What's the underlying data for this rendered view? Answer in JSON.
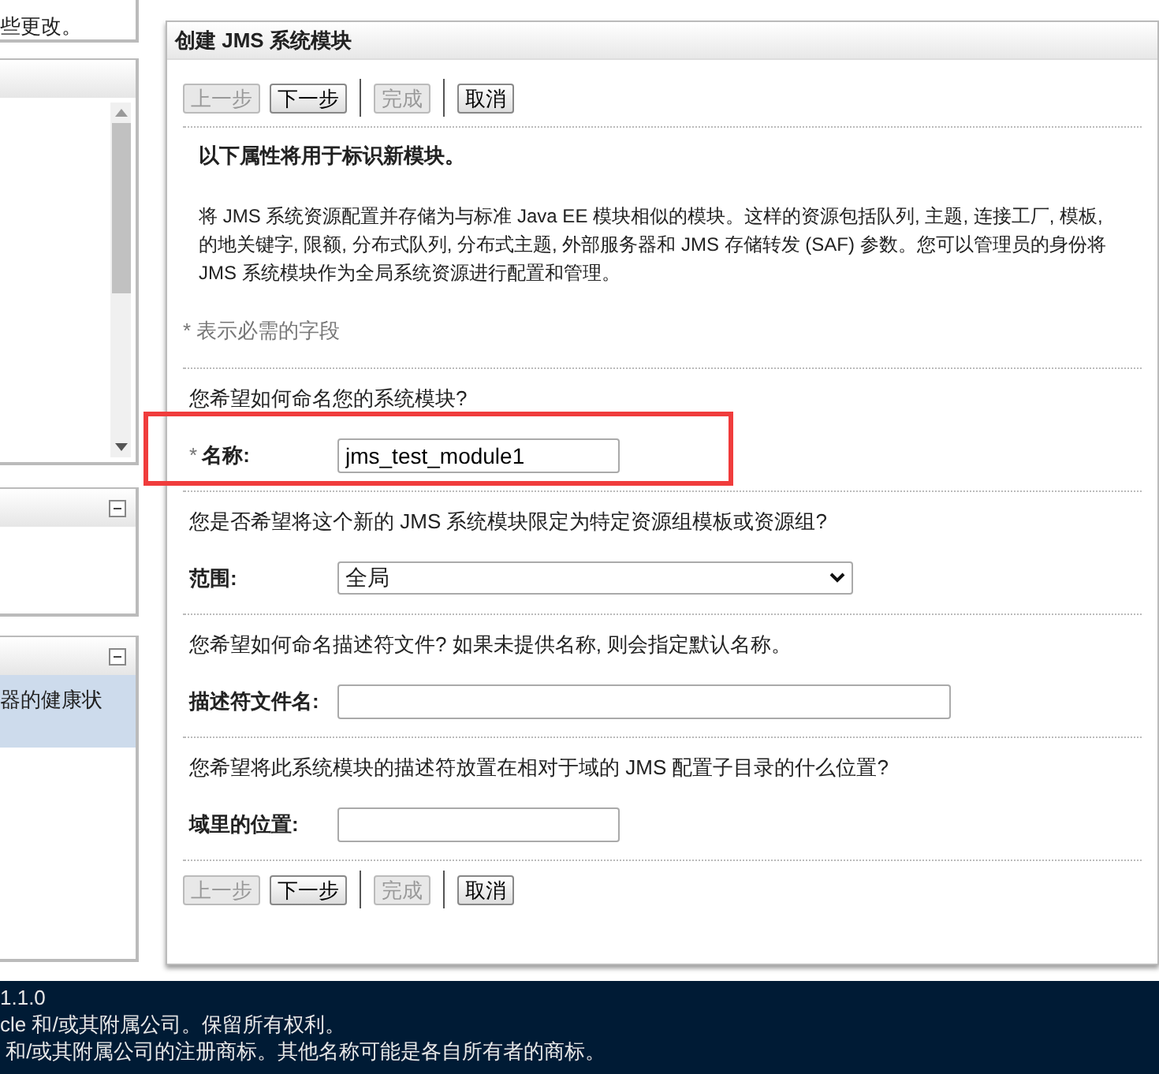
{
  "sidebar": {
    "notice": "些更改。",
    "health_item": "器的健康状"
  },
  "dialog": {
    "title": "创建 JMS 系统模块",
    "buttons": [
      {
        "label": "上一步",
        "disabled": true
      },
      {
        "label": "下一步",
        "disabled": false
      },
      {
        "label": "完成",
        "disabled": true
      },
      {
        "label": "取消",
        "disabled": false
      }
    ],
    "heading": "以下属性将用于标识新模块。",
    "description": [
      "将 JMS 系统资源配置并存储为与标准 Java EE 模块相似的模块。这样的资源包括队列, 主题, 连接工厂, 模板,",
      "的地关键字, 限额, 分布式队列, 分布式主题, 外部服务器和 JMS 存储转发 (SAF) 参数。您可以管理员的身份将",
      "JMS 系统模块作为全局系统资源进行配置和管理。"
    ],
    "required_note": "* 表示必需的字段",
    "fields": [
      {
        "question": "您希望如何命名您的系统模块?",
        "required_mark": "*",
        "label": "名称:",
        "kind": "text",
        "value": "jms_test_module1",
        "annotated": true
      },
      {
        "question": "您是否希望将这个新的 JMS 系统模块限定为特定资源组模板或资源组?",
        "label": "范围:",
        "kind": "select",
        "value": "全局",
        "annotated": false
      },
      {
        "question": "您希望如何命名描述符文件? 如果未提供名称, 则会指定默认名称。",
        "label": "描述符文件名:",
        "kind": "text",
        "annotated": false
      },
      {
        "question": "您希望将此系统模块的描述符放置在相对于域的 JMS 配置子目录的什么位置?",
        "label": "域里的位置:",
        "kind": "text",
        "annotated": false
      }
    ],
    "bottom_buttons": [
      {
        "label": "上一步",
        "disabled": true
      },
      {
        "label": "下一步",
        "disabled": false
      },
      {
        "label": "完成",
        "disabled": true
      },
      {
        "label": "取消",
        "disabled": false
      }
    ]
  },
  "footer": {
    "lines": [
      "1.1.0",
      "cle 和/或其附属公司。保留所有权利。",
      " 和/或其附属公司的注册商标。其他名称可能是各自所有者的商标。"
    ]
  }
}
